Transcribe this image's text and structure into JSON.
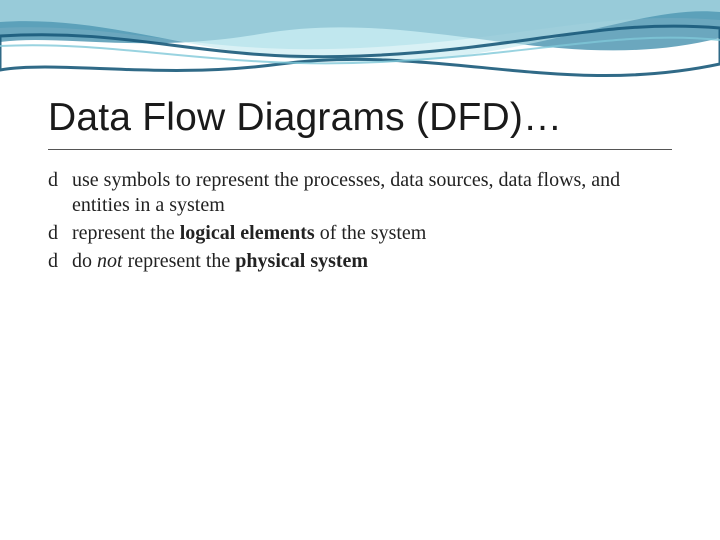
{
  "slide": {
    "title": "Data Flow Diagrams (DFD)…",
    "bullet_glyph": "d",
    "bullets": [
      {
        "pre": "use symbols to represent the processes, data sources, data flows, and entities in a system",
        "bold": "",
        "post": ""
      },
      {
        "pre": "represent the ",
        "bold": "logical elements",
        "post": " of the system"
      },
      {
        "pre": "do ",
        "italic": "not",
        "mid": " represent the ",
        "bold": "physical system",
        "post": ""
      }
    ]
  },
  "theme": {
    "wave_blue_dark": "#1a5a7a",
    "wave_blue_light": "#7fc8d8",
    "wave_teal": "#5fb5c5"
  }
}
